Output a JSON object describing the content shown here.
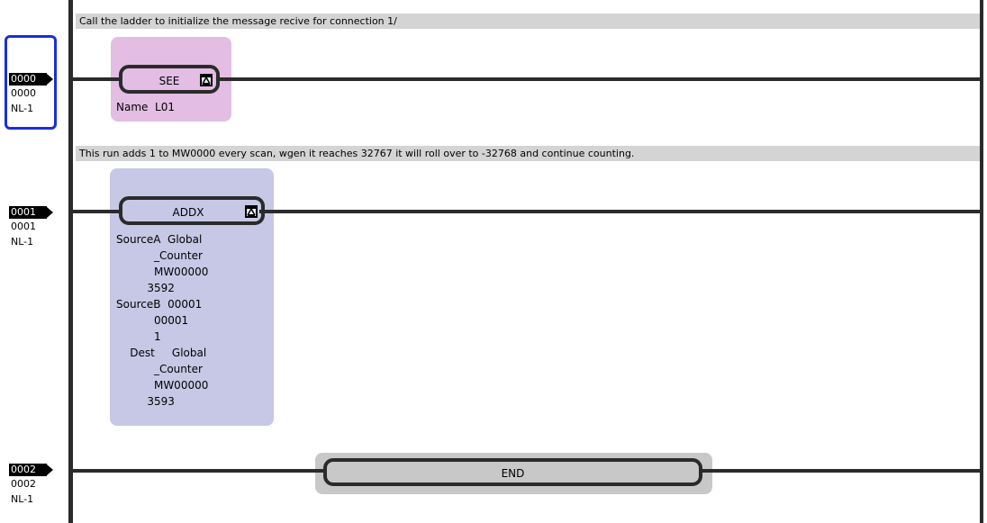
{
  "rungs": [
    {
      "tag": "0000",
      "number": "0000",
      "netlabel": "NL-1",
      "comment": "Call the ladder to initialize the message recive for connection 1/",
      "instruction": {
        "name": "SEE",
        "params": [
          "Name  L01"
        ]
      }
    },
    {
      "tag": "0001",
      "number": "0001",
      "netlabel": "NL-1",
      "comment": "This run adds 1 to MW0000 every scan, wgen it reaches 32767 it will roll over to -32768 and continue counting.",
      "instruction": {
        "name": "ADDX",
        "params": [
          "SourceA  Global",
          "           _Counter",
          "           MW00000",
          "         3592",
          "SourceB  00001",
          "           00001",
          "           1",
          "    Dest     Global",
          "           _Counter",
          "           MW00000",
          "         3593"
        ]
      }
    },
    {
      "tag": "0002",
      "number": "0002",
      "netlabel": "NL-1",
      "instruction": {
        "name": "END"
      }
    }
  ],
  "icons": {
    "expand": "expand-toggle-icon",
    "rung_marker": "rung-arrow-icon"
  },
  "colors": {
    "see_block": "#e3bde3",
    "addx_block": "#c7c8e6",
    "end_block": "#c8c8c8",
    "selection": "#1a2fd8",
    "comment_bar": "#d4d4d4"
  }
}
